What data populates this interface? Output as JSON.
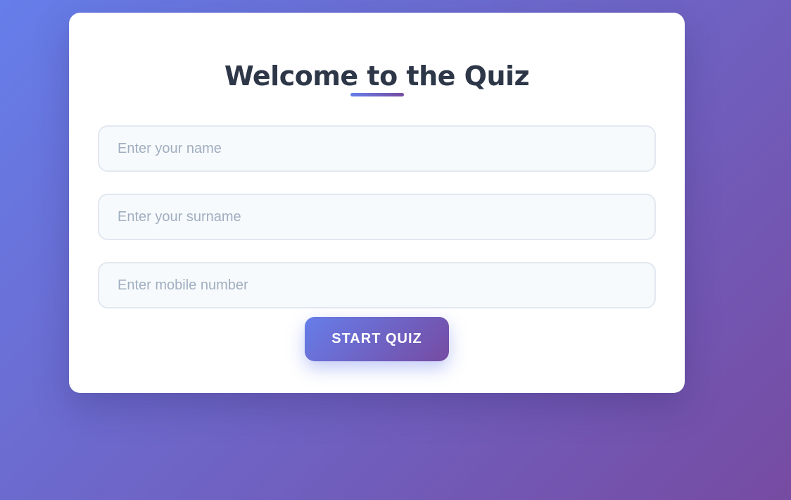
{
  "page": {
    "background_gradient": [
      "#667eea",
      "#764ba2"
    ]
  },
  "card": {
    "title": "Welcome to the Quiz",
    "accent_color": "#764ba2",
    "fields": {
      "name": {
        "value": "",
        "placeholder": "Enter your name"
      },
      "surname": {
        "value": "",
        "placeholder": "Enter your surname"
      },
      "mobile": {
        "value": "",
        "placeholder": "Enter mobile number"
      }
    },
    "start_button_label": "START QUIZ"
  }
}
